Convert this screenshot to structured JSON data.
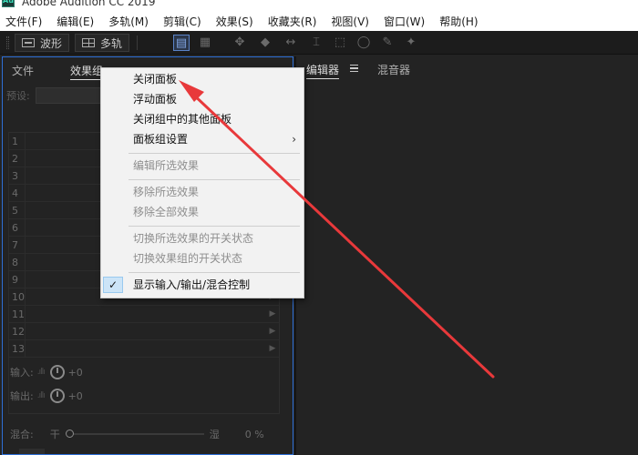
{
  "window": {
    "title": "Adobe Audition CC 2019",
    "icon_text": "Au"
  },
  "menubar": {
    "items": [
      "文件(F)",
      "编辑(E)",
      "多轨(M)",
      "剪辑(C)",
      "效果(S)",
      "收藏夹(R)",
      "视图(V)",
      "窗口(W)",
      "帮助(H)"
    ]
  },
  "toolbar": {
    "waveform_label": "波形",
    "multitrack_label": "多轨"
  },
  "left_panel": {
    "tabs": [
      "文件",
      "效果组"
    ],
    "preset_label": "预设:",
    "slots": [
      "1",
      "2",
      "3",
      "4",
      "5",
      "6",
      "7",
      "8",
      "9",
      "10",
      "11",
      "12",
      "13"
    ],
    "input_label": "输入:",
    "input_value": "+0",
    "output_label": "输出:",
    "output_value": "+0",
    "mix_label": "混合:",
    "mix_dry": "干",
    "mix_wet": "湿",
    "mix_value": "0 %"
  },
  "right_panel": {
    "tabs": [
      "编辑器",
      "混音器"
    ]
  },
  "context_menu": {
    "items": [
      {
        "label": "关闭面板",
        "enabled": true
      },
      {
        "label": "浮动面板",
        "enabled": true
      },
      {
        "label": "关闭组中的其他面板",
        "enabled": true
      },
      {
        "label": "面板组设置",
        "enabled": true,
        "submenu": true
      },
      {
        "label": "编辑所选效果",
        "enabled": false
      },
      {
        "label": "移除所选效果",
        "enabled": false
      },
      {
        "label": "移除全部效果",
        "enabled": false
      },
      {
        "label": "切换所选效果的开关状态",
        "enabled": false
      },
      {
        "label": "切换效果组的开关状态",
        "enabled": false
      },
      {
        "label": "显示输入/输出/混合控制",
        "enabled": true,
        "checked": true
      }
    ]
  },
  "colors": {
    "panel_bg": "#232323",
    "focus_border": "#2e6fd6",
    "menu_bg": "#f2f2f2",
    "annotation_arrow": "#e8393b",
    "check_highlight": "#cce4f7"
  }
}
